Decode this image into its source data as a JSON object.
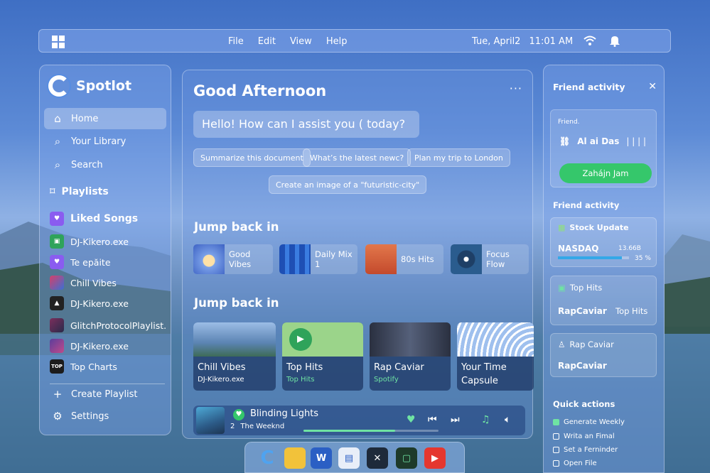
{
  "menubar": {
    "menus": [
      "File",
      "Edit",
      "View",
      "Help"
    ],
    "date": "Tue, April2",
    "time": "11:01 AM",
    "wifi_icon": "wifi-icon",
    "bell_icon": "bell-icon"
  },
  "sidebar": {
    "app_name": "Spotlot",
    "nav": [
      {
        "label": "Home",
        "icon": "home-icon"
      },
      {
        "label": "Your Library",
        "icon": "search-icon"
      },
      {
        "label": "Search",
        "icon": "search-icon"
      }
    ],
    "playlists_title": "Playlists",
    "liked_songs": "Liked Songs",
    "playlists": [
      {
        "label": "DJ-Kikero.exe",
        "color": "#2fa35a"
      },
      {
        "label": "Te epăite",
        "color": "#8a5cf0"
      },
      {
        "label": "Chill Vibes",
        "color": "#d4406a"
      },
      {
        "label": "DJ-Kikero.exe",
        "color": "#222222"
      },
      {
        "label": "GlitchProtocolPlaylist...",
        "color": "#7a2e5c"
      },
      {
        "label": "DJ-Kikero.exe",
        "color": "#5a3e9c"
      },
      {
        "label": "Top Charts",
        "color": "#1c1c1c"
      }
    ],
    "create_playlist": "Create Playlist",
    "settings": "Settings"
  },
  "main": {
    "greeting": "Good Afternoon",
    "more": "···",
    "prompt": "Hello! How can I assist you ( today?",
    "chips": [
      "Summarize this document",
      "What’s the latest newc?",
      "Plan my trip to London",
      "Create an image of a \"futuristic-city\""
    ],
    "jump_back_title_1": "Jump back in",
    "jump_back_title_2": "Jump back in",
    "jump_cards": [
      "Good Vibes",
      "Daily Mix 1",
      "80s Hits",
      "Focus Flow"
    ],
    "big_cards": [
      {
        "title": "Chill Vibes",
        "sub": "DJ-Kikero.exe"
      },
      {
        "title": "Top Hits",
        "sub": "Top Hits"
      },
      {
        "title": "Rap Caviar",
        "sub": "Spotify"
      },
      {
        "title": "Your Time Capsule",
        "sub": ""
      }
    ],
    "player": {
      "title": "Blinding Lights",
      "track_no": "2",
      "artist": "The Weeknd",
      "progress": 0.68
    }
  },
  "right": {
    "title": "Friend activity",
    "friend_label": "Friend.",
    "friend_name": "Al ai Das",
    "friend_bars": "| | | |",
    "jam_button": "Zahájn Jam",
    "activity_title": "Friend activity",
    "stock_title": "Stock Update",
    "stock_name": "NASDAQ",
    "stock_value": "13.66B",
    "stock_pct": "35 %",
    "stock_fill": 0.9,
    "top_hits": "Top Hits",
    "rap_caviar_1": "RapCaviar",
    "top_hits_2": "Top Hits",
    "rap_caviar_title": "Rap Caviar",
    "rap_caviar_2": "RapCaviar",
    "quick_title": "Quick actions",
    "quick": [
      "Generate Weekly",
      "Writa an Fimal",
      "Set a Ferninder",
      "Open File"
    ]
  },
  "dock": [
    "C",
    "folder-icon",
    "W",
    "calendar-icon",
    "xbox-icon",
    "terminal-icon",
    "youtube-icon"
  ]
}
